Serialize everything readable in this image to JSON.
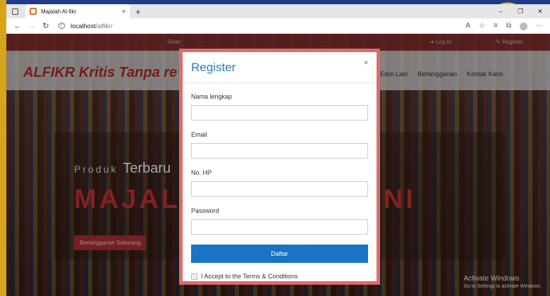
{
  "browser": {
    "tab_title": "Majalah Al-fikr",
    "tab_close": "×",
    "new_tab": "+",
    "url_host": "localhost",
    "url_path": "/alfikr/"
  },
  "site": {
    "top_center": "Selar",
    "login": "Log In",
    "register": "Register",
    "brand": "ALFIKR Kritis Tanpa re",
    "menu": [
      "Edisi Lain",
      "Berlangganan",
      "Kontak Kami"
    ],
    "hero_small": "Produk",
    "hero_bold": "Terbaru",
    "hero_title": "MAJALAH",
    "hero_title_tail": "RI INI",
    "hero_button": "Berlangganan Sekarang"
  },
  "modal": {
    "title": "Register",
    "close": "×",
    "fields": [
      {
        "label": "Nama lengkap",
        "value": ""
      },
      {
        "label": "Email",
        "value": ""
      },
      {
        "label": "No. HP",
        "value": ""
      },
      {
        "label": "Password",
        "value": ""
      }
    ],
    "submit": "Daftar",
    "accept_label": "I Accept to the Terms & Conditions"
  },
  "watermark": {
    "title": "Activate Windows",
    "subtitle": "Go to Settings to activate Windows."
  }
}
